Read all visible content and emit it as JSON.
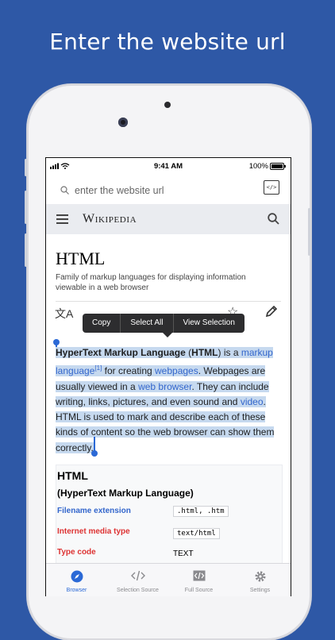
{
  "headline": "Enter the website url",
  "status": {
    "time": "9:41 AM",
    "battery": "100%"
  },
  "url_bar": {
    "placeholder": "enter the website url"
  },
  "wiki_header": {
    "logo": "Wikipedia"
  },
  "article": {
    "title": "HTML",
    "description": "Family of markup languages for displaying information viewable in a web browser"
  },
  "context_menu": {
    "items": [
      "Copy",
      "Select All",
      "View Selection"
    ]
  },
  "paragraph": {
    "p1_bold": "HyperText Markup Language",
    "p2": " (",
    "p3_bold": "HTML",
    "p4": ") is a ",
    "p5_link": "markup language",
    "p6_ref": "[1]",
    "p7": " for creating ",
    "p8_link": "webpages",
    "p9": ". Webpages are usually viewed in a ",
    "p10_link": "web browser",
    "p11": ". They can include writing, links, pictures, and even sound and ",
    "p12_link": "video",
    "p13": ". HTML is used to mark and describe each of these kinds of content so the web browser can show them correctly."
  },
  "infobox": {
    "title": "HTML",
    "subtitle": "(HyperText Markup Language)",
    "rows": [
      {
        "label": "Filename extension",
        "value": ".html, .htm",
        "color": "#3366cc"
      },
      {
        "label": "Internet media type",
        "value": "text/html",
        "color": "#d33"
      },
      {
        "label": "Type code",
        "value": "TEXT",
        "color": "#d33"
      }
    ]
  },
  "tabs": [
    {
      "label": "Browser",
      "icon": "compass-icon",
      "active": true
    },
    {
      "label": "Selection Source",
      "icon": "code-brackets-icon"
    },
    {
      "label": "Full Source",
      "icon": "code-document-icon"
    },
    {
      "label": "Settings",
      "icon": "gear-icon"
    }
  ],
  "colors": {
    "background": "#2e58a6",
    "accent": "#2b69d6",
    "link": "#3366cc",
    "selection": "#c6d9ef"
  }
}
